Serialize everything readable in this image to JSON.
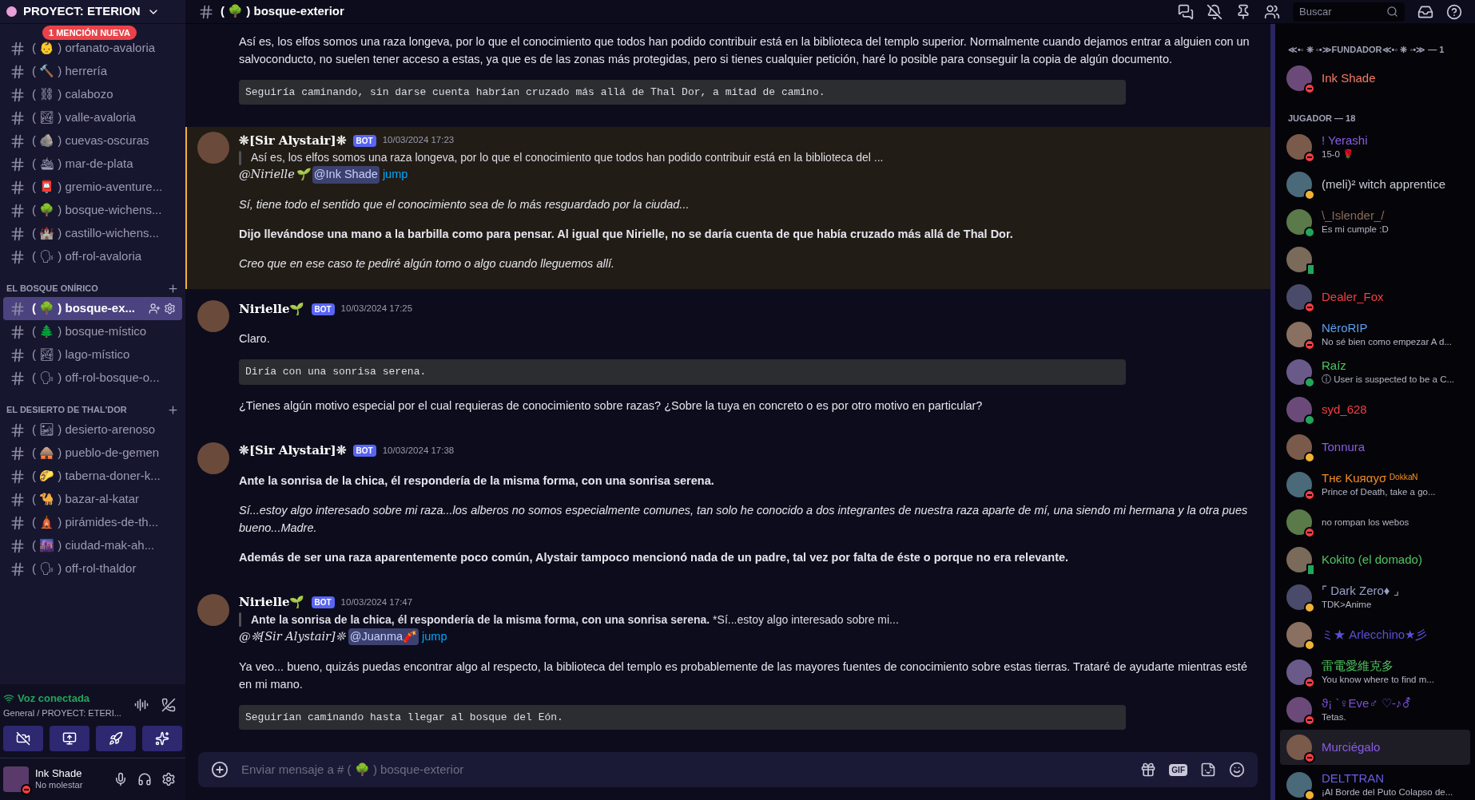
{
  "server": {
    "name": "PROYECT: ETERION",
    "mention_badge": "1 MENCIÓN NUEVA"
  },
  "channel_groups": [
    {
      "channels": [
        {
          "label": "( 👶 ) orfanato-avaloria",
          "selected": false
        },
        {
          "label": "( 🔨 ) herrería",
          "selected": false
        },
        {
          "label": "( ⛓ ) calabozo",
          "selected": false
        },
        {
          "label": "( 🏞 ) valle-avaloria",
          "selected": false
        },
        {
          "label": "( 🪨 ) cuevas-oscuras",
          "selected": false
        },
        {
          "label": "( 🛳 ) mar-de-plata",
          "selected": false
        },
        {
          "label": "( 📮 ) gremio-aventure...",
          "selected": false
        },
        {
          "label": "( 🌳 ) bosque-wichens...",
          "selected": false
        },
        {
          "label": "( 🏰 ) castillo-wichens...",
          "selected": false
        },
        {
          "label": "( 🗣 ) off-rol-avaloria",
          "selected": false
        }
      ]
    },
    {
      "category": "EL BOSQUE ONÍRICO",
      "channels": [
        {
          "label": "( 🌳 ) bosque-ex...",
          "selected": true
        },
        {
          "label": "( 🌲 ) bosque-místico",
          "selected": false
        },
        {
          "label": "( 🏞 ) lago-místico",
          "selected": false
        },
        {
          "label": "( 🗣 ) off-rol-bosque-o...",
          "selected": false
        }
      ]
    },
    {
      "category": "EL DESIERTO DE THAL'DOR",
      "channels": [
        {
          "label": "( 🏜 ) desierto-arenoso",
          "selected": false
        },
        {
          "label": "( 🛖 ) pueblo-de-gemen",
          "selected": false
        },
        {
          "label": "( 🌮 ) taberna-doner-k...",
          "selected": false
        },
        {
          "label": "( 🐪 ) bazar-al-katar",
          "selected": false
        },
        {
          "label": "( 🛕 ) pirámides-de-th...",
          "selected": false
        },
        {
          "label": "( 🌆 ) ciudad-mak-ah...",
          "selected": false
        },
        {
          "label": "( 🗣 ) off-rol-thaldor",
          "selected": false
        }
      ]
    }
  ],
  "voice": {
    "status": "Voz conectada",
    "location": "General / PROYECT: ETERI..."
  },
  "user": {
    "name": "Ink Shade",
    "status": "No molestar"
  },
  "channel_header": {
    "name": "( 🌳 ) bosque-exterior",
    "search_placeholder": "Buscar"
  },
  "messages": [
    {
      "highlighted": false,
      "paragraphs": [
        {
          "kind": "text",
          "text": "Así es, los elfos somos una raza longeva, por lo que el conocimiento que todos han podido contribuir está en la biblioteca del templo superior. Normalmente cuando dejamos entrar a alguien con un salvoconducto, no suelen tener acceso a estas, ya que es de las zonas más protegidas, pero si tienes cualquier petición, haré lo posible para conseguir la copia de algún documento."
        },
        {
          "kind": "code",
          "text": "Seguiría caminando, sin darse cuenta habrían cruzado más allá de Thal Dor, a mitad de camino."
        }
      ]
    },
    {
      "author": "❊[Sir Alystair]❊",
      "badge": "BOT",
      "time": "10/03/2024 17:23",
      "highlighted": true,
      "quote": "Así es, los elfos somos una raza longeva, por lo que el conocimiento que todos han podido contribuir está en la biblioteca del ...",
      "reply": {
        "who": "@Nirielle🌱",
        "mention": "@Ink Shade",
        "link": "jump"
      },
      "paragraphs": [
        {
          "kind": "italic",
          "text": "Sí, tiene todo el sentido que el conocimiento sea de lo más resguardado por la ciudad..."
        },
        {
          "kind": "bold",
          "text": "Dijo llevándose una mano a la barbilla como para pensar. Al igual que Nirielle, no se daría cuenta de que había cruzado más allá de Thal Dor."
        },
        {
          "kind": "italic",
          "text": "Creo que en ese caso te pediré algún tomo o algo cuando lleguemos allí."
        }
      ]
    },
    {
      "author": "Nirielle🌱",
      "badge": "BOT",
      "time": "10/03/2024 17:25",
      "highlighted": false,
      "paragraphs": [
        {
          "kind": "text",
          "text": "Claro."
        },
        {
          "kind": "code",
          "text": "Diría con una sonrisa serena."
        },
        {
          "kind": "text",
          "text": "¿Tienes algún motivo especial por el cual requieras de conocimiento sobre razas? ¿Sobre la tuya en concreto o es por otro motivo en particular?"
        }
      ]
    },
    {
      "author": "❊[Sir Alystair]❊",
      "badge": "BOT",
      "time": "10/03/2024 17:38",
      "highlighted": false,
      "paragraphs": [
        {
          "kind": "bold",
          "text": "Ante la sonrisa de la chica, él respondería de la misma forma, con una sonrisa serena."
        },
        {
          "kind": "italic",
          "text": "Sí...estoy algo interesado sobre mi raza...los alberos no somos especialmente comunes, tan solo he conocido a dos integrantes de nuestra raza aparte de mí, una siendo mi hermana y la otra pues bueno...Madre."
        },
        {
          "kind": "bold",
          "text": "Además de ser una raza aparentemente poco común, Alystair tampoco mencionó nada de un padre, tal vez por falta de éste o porque no era relevante."
        }
      ]
    },
    {
      "author": "Nirielle🌱",
      "badge": "BOT",
      "time": "10/03/2024 17:47",
      "highlighted": false,
      "quote": "**Ante la sonrisa de la chica, él respondería de la misma forma, con una sonrisa serena.**  *Sí...estoy algo interesado sobre mi...",
      "reply": {
        "who": "@❊[Sir Alystair]❊",
        "mention": "@Juanma🧨",
        "link": "jump"
      },
      "paragraphs": [
        {
          "kind": "text",
          "text": " Ya veo... bueno, quizás puedas encontrar algo al respecto, la biblioteca del templo es probablemente de las mayores fuentes de conocimiento sobre estas tierras. Trataré de ayudarte mientras esté en mi mano."
        },
        {
          "kind": "code",
          "text": "Seguirían caminando hasta llegar al bosque del Eón."
        }
      ]
    }
  ],
  "composer": {
    "placeholder": "Enviar mensaje a # ( 🌳 ) bosque-exterior",
    "gif": "GIF"
  },
  "member_groups": [
    {
      "title": "≪•◦ ❈ ◦•≫FUNDADOR≪•◦ ❈ ◦•≫ — 1",
      "members": [
        {
          "name": "Ink Shade",
          "color": "#f47b67",
          "kind": "dnd",
          "selected": false
        }
      ]
    },
    {
      "title": "JUGADOR — 18",
      "members": [
        {
          "name": "! Yerashi",
          "color": "#8a5ce6",
          "kind": "dnd",
          "sub": "15-0 🌹",
          "selected": false
        },
        {
          "name": "(meli)² witch apprentice",
          "color": "#c9cbd6",
          "kind": "idle",
          "selected": false
        },
        {
          "name": "\\_Islender_/",
          "color": "#8a6a55",
          "kind": "online",
          "sub": "Es mi cumple :D",
          "selected": false
        },
        {
          "kind": "mobile",
          "selected": false
        },
        {
          "name": "Dealer_Fox",
          "color": "#f23f43",
          "kind": "dnd",
          "selected": false
        },
        {
          "name": "NëroRIP",
          "color": "#5ea0f0",
          "kind": "dnd",
          "sub": "No sé bien como empezar A d...",
          "selected": false
        },
        {
          "name": "Raíz",
          "color": "#4fc45f",
          "kind": "online",
          "sub": "ⓘ User is suspected to be a C...",
          "selected": false
        },
        {
          "name": "syd_628",
          "color": "#f23f43",
          "kind": "online",
          "selected": false
        },
        {
          "name": "Tonnura",
          "color": "#8a5ce6",
          "kind": "idle",
          "selected": false
        },
        {
          "name": "Тнє Kuяαуσ ᴰᵒᵏᵏᵃᴺ",
          "color": "#f08a24",
          "kind": "dnd",
          "sub": "Prince of Death, take a go...",
          "selected": false
        },
        {
          "kind": "dnd",
          "sub": "no rompan los webos",
          "selected": false
        },
        {
          "name": "Kokito (el domado)",
          "color": "#4fc45f",
          "kind": "mobile",
          "selected": false
        },
        {
          "name": "⌜ Dark Zero♦ ⌟",
          "color": "#9aa0c8",
          "kind": "idle",
          "sub": "TDK>Anime",
          "selected": false
        },
        {
          "name": "ミ★ Arlecchino★彡",
          "color": "#5b4fd6",
          "kind": "idle",
          "selected": false
        },
        {
          "name": "雷電愛維克多",
          "color": "#4fc45f",
          "kind": "dnd",
          "sub": "You know where to find m...",
          "selected": false
        },
        {
          "name": "ϑ¡ ˋ♀Eve♂ ♡-♪⚦",
          "color": "#7a4fd6",
          "kind": "dnd",
          "sub": "Tetas.",
          "selected": false
        },
        {
          "name": "Murciégalo",
          "color": "#8a5ce6",
          "kind": "dnd",
          "selected": true
        },
        {
          "name": "DELTTRAN",
          "color": "#6a5ce6",
          "kind": "idle",
          "sub": "¡Al Borde del Puto Colapso de...",
          "selected": false
        }
      ]
    }
  ]
}
